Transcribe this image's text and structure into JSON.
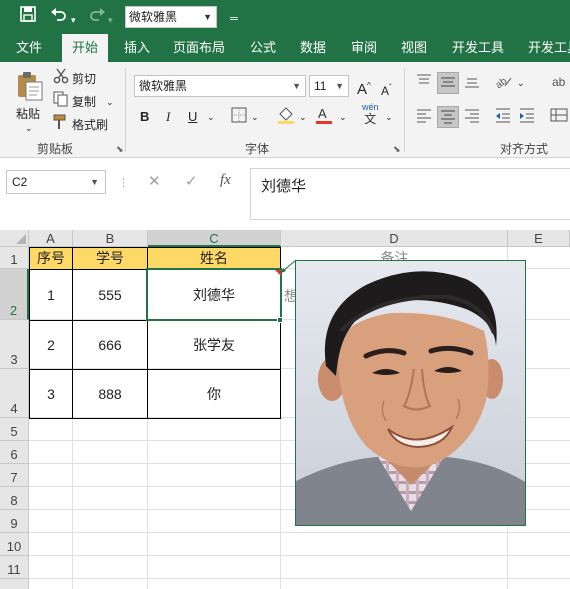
{
  "titlebar": {
    "save_icon": "save-icon",
    "undo_icon": "undo-icon",
    "redo_icon": "redo-icon",
    "font_value": "微软雅黑",
    "customize_icon": "customize-qat-icon"
  },
  "tabs": [
    {
      "label": "文件"
    },
    {
      "label": "开始"
    },
    {
      "label": "插入"
    },
    {
      "label": "页面布局"
    },
    {
      "label": "公式"
    },
    {
      "label": "数据"
    },
    {
      "label": "审阅"
    },
    {
      "label": "视图"
    },
    {
      "label": "开发工具"
    },
    {
      "label": "开发工具"
    }
  ],
  "ribbon": {
    "clipboard": {
      "paste": "粘贴",
      "cut": "剪切",
      "copy": "复制",
      "format_painter": "格式刷",
      "group_label": "剪贴板"
    },
    "font": {
      "font_name": "微软雅黑",
      "font_size": "11",
      "grow": "A",
      "shrink": "A",
      "bold": "B",
      "italic": "I",
      "underline": "U",
      "phonetic": "wén",
      "phonetic_sub": "文",
      "group_label": "字体",
      "font_color": "#e0382a",
      "fill_color": "#ffd966"
    },
    "alignment": {
      "group_label": "对齐方式",
      "wrap": "ab"
    }
  },
  "formula_bar": {
    "name_box": "C2",
    "cancel": "✕",
    "enter": "✓",
    "fx": "fx",
    "content": "刘德华"
  },
  "sheet": {
    "columns": [
      "A",
      "B",
      "C",
      "D",
      "E"
    ],
    "rows": [
      "1",
      "2",
      "3",
      "4",
      "5",
      "6",
      "7",
      "8",
      "9",
      "10",
      "11"
    ],
    "header": {
      "seq": "序号",
      "id": "学号",
      "name": "姓名"
    },
    "data": [
      {
        "seq": "1",
        "id": "555",
        "name": "刘德华"
      },
      {
        "seq": "2",
        "id": "666",
        "name": "张学友"
      },
      {
        "seq": "3",
        "id": "888",
        "name": "你"
      }
    ],
    "d1_partial": "备注",
    "d2_partial": "想",
    "selected_cell": "C2",
    "header_fill": "#ffd966"
  },
  "comment": {
    "image_name": "comment-photo"
  }
}
